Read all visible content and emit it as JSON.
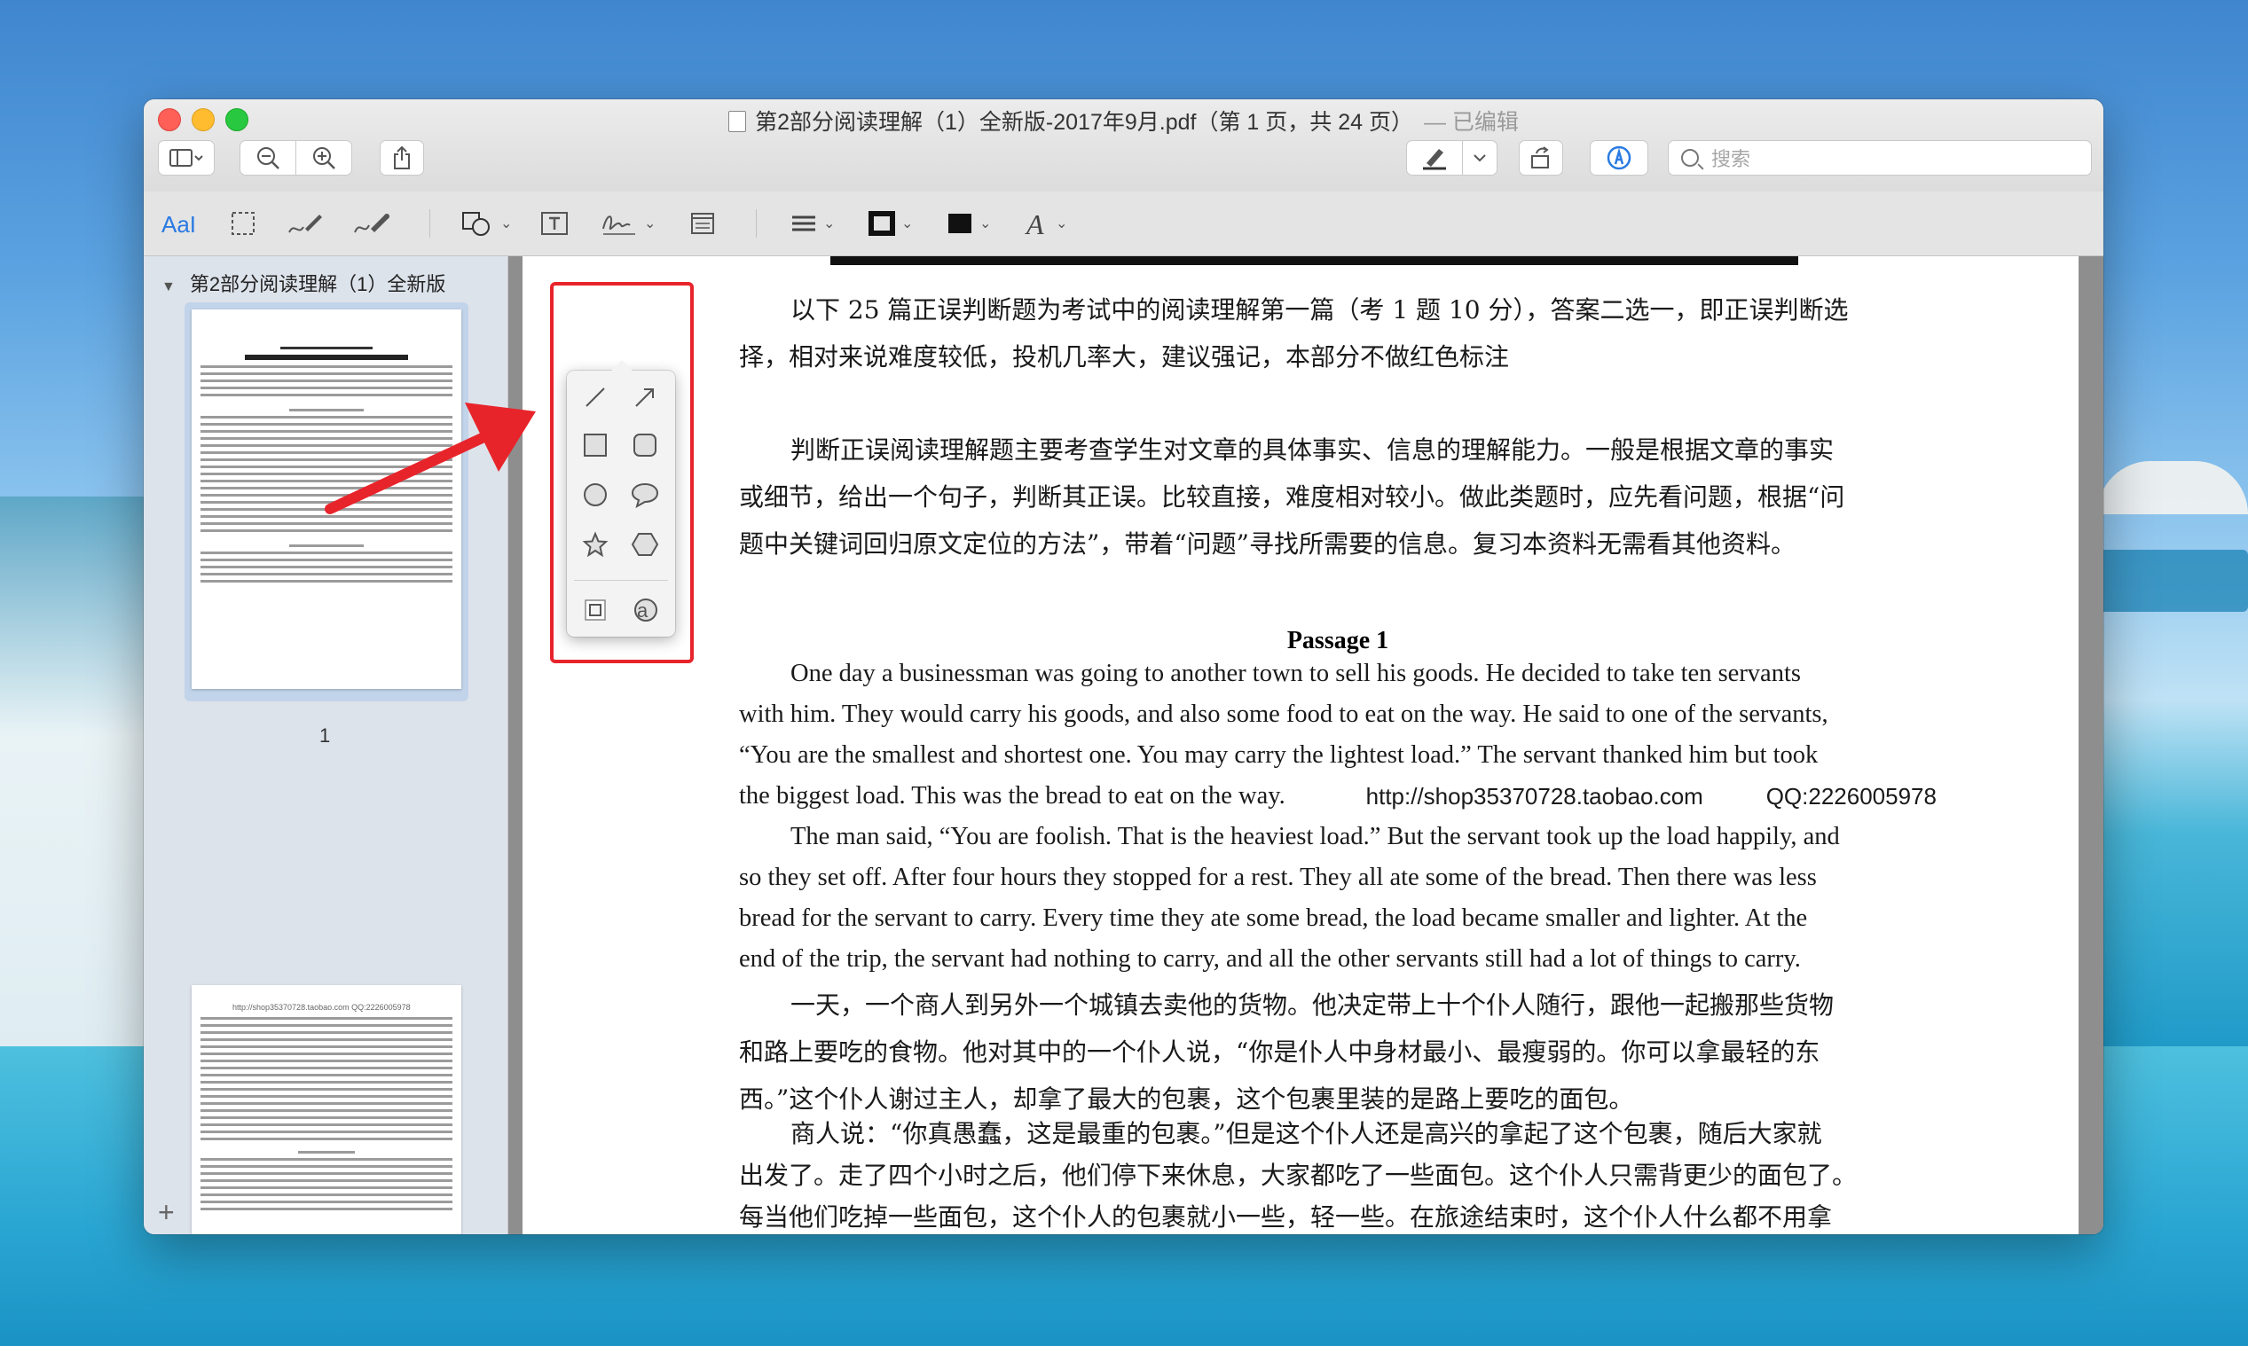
{
  "window": {
    "title": "第2部分阅读理解（1）全新版-2017年9月.pdf（第 1 页，共 24 页）",
    "title_suffix": "— 已编辑"
  },
  "toolbar": {
    "search_placeholder": "搜索"
  },
  "sidebar": {
    "document_name": "第2部分阅读理解（1）全新版",
    "page_label": "1",
    "thumb2_header": "http://shop35370728.taobao.com    QQ:2226005978"
  },
  "document": {
    "intro_line1": "以下 25 篇正误判断题为考试中的阅读理解第一篇（考 1 题 10 分），答案二选一，即正误判断选",
    "intro_line2": "择，相对来说难度较低，投机几率大，建议强记，本部分不做红色标注",
    "method_line1": "判断正误阅读理解题主要考查学生对文章的具体事实、信息的理解能力。一般是根据文章的事实",
    "method_line2": "或细节，给出一个句子，判断其正误。比较直接，难度相对较小。做此类题时，应先看问题，根据“问",
    "method_line3": "题中关键词回归原文定位的方法”，带着“问题”寻找所需要的信息。复习本资料无需看其他资料。",
    "passage_title": "Passage 1",
    "en_p1_l1": "One day a businessman was going to another town to sell his goods. He decided to take ten servants",
    "en_p1_l2": "with him. They would carry his goods, and also some food to eat on the way. He said to one of the servants,",
    "en_p1_l3": "“You are the smallest and shortest one. You may carry the lightest load.” The servant thanked him but took",
    "en_p1_l4": "the biggest load. This was the bread to eat on the way.",
    "url": "http://shop35370728.taobao.com",
    "qq": "QQ:2226005978",
    "en_p2_l1": "The man said, “You are foolish. That is the heaviest load.” But the servant took up the load happily, and",
    "en_p2_l2": "so they set off. After four hours they stopped for a rest. They all ate some of the bread. Then there was less",
    "en_p2_l3": "bread for the servant to carry. Every time they ate some bread, the load became smaller and lighter. At the",
    "en_p2_l4": "end of the trip, the servant had nothing to carry, and all the other servants still had a lot of things to carry.",
    "cn_p1_l1": "一天，一个商人到另外一个城镇去卖他的货物。他决定带上十个仆人随行，跟他一起搬那些货物",
    "cn_p1_l2": "和路上要吃的食物。他对其中的一个仆人说，“你是仆人中身材最小、最瘦弱的。你可以拿最轻的东",
    "cn_p1_l3": "西。”这个仆人谢过主人，却拿了最大的包裹，这个包裹里装的是路上要吃的面包。",
    "cn_p2_l1": "商人说：“你真愚蠢，这是最重的包裹。”但是这个仆人还是高兴的拿起了这个包裹，随后大家就",
    "cn_p2_l2": "出发了。走了四个小时之后，他们停下来休息，大家都吃了一些面包。这个仆人只需背更少的面包了。",
    "cn_p2_l3": "每当他们吃掉一些面包，这个仆人的包裹就小一些，轻一些。在旅途结束时，这个仆人什么都不用拿"
  },
  "colors": {
    "highlight_red": "#e8242b",
    "accent_blue": "#2a7ae2"
  }
}
